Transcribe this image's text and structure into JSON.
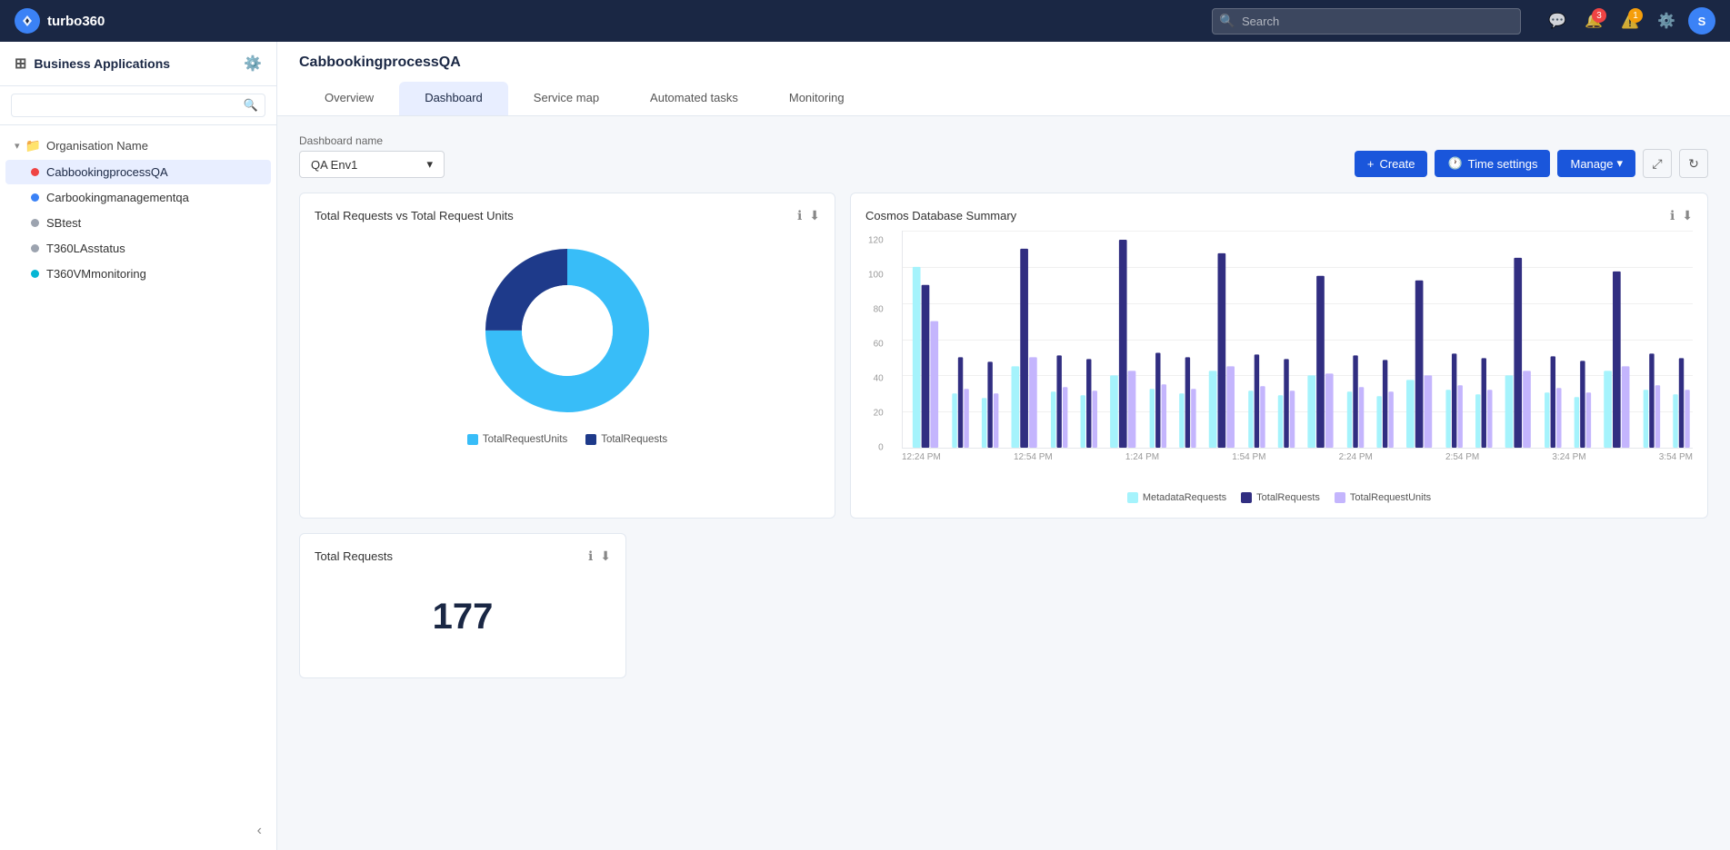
{
  "app": {
    "name": "turbo360",
    "logo_char": "T"
  },
  "topnav": {
    "search_placeholder": "Search",
    "notification_badge": "3",
    "alert_badge": "1",
    "avatar_char": "S"
  },
  "sidebar": {
    "title": "Business Applications",
    "search_placeholder": "",
    "org_name": "Organisation Name",
    "items": [
      {
        "id": "cabbookingprocessqa",
        "label": "CabbookingprocessQA",
        "dot": "red",
        "active": true
      },
      {
        "id": "carbookingmanagementqa",
        "label": "Carbookingmanagementqa",
        "dot": "blue",
        "active": false
      },
      {
        "id": "sbtest",
        "label": "SBtest",
        "dot": "gray",
        "active": false
      },
      {
        "id": "t360lastatus",
        "label": "T360LAsstatus",
        "dot": "gray",
        "active": false
      },
      {
        "id": "t360vmmonitoring",
        "label": "T360VMmonitoring",
        "dot": "teal",
        "active": false
      }
    ]
  },
  "main": {
    "title": "CabbookingprocessQA",
    "tabs": [
      {
        "id": "overview",
        "label": "Overview",
        "active": false
      },
      {
        "id": "dashboard",
        "label": "Dashboard",
        "active": true
      },
      {
        "id": "service-map",
        "label": "Service map",
        "active": false
      },
      {
        "id": "automated-tasks",
        "label": "Automated tasks",
        "active": false
      },
      {
        "id": "monitoring",
        "label": "Monitoring",
        "active": false
      }
    ],
    "dashboard": {
      "name_label": "Dashboard name",
      "dropdown_value": "QA Env1",
      "buttons": {
        "create": "+ Create",
        "time_settings": "Time settings",
        "manage": "Manage"
      }
    },
    "charts": {
      "donut": {
        "title": "Total Requests vs Total Request Units",
        "legend": [
          {
            "label": "TotalRequestUnits",
            "color": "#38bdf8"
          },
          {
            "label": "TotalRequests",
            "color": "#1e3a8a"
          }
        ],
        "values": [
          75,
          25
        ]
      },
      "bar": {
        "title": "Cosmos Database Summary",
        "y_labels": [
          "120",
          "100",
          "80",
          "60",
          "40",
          "20",
          "0"
        ],
        "x_labels": [
          "12:24 PM",
          "12:54 PM",
          "1:24 PM",
          "1:54 PM",
          "2:24 PM",
          "2:54 PM",
          "3:24 PM",
          "3:54 PM"
        ],
        "legend": [
          {
            "label": "MetadataRequests",
            "color": "#a5f3fc"
          },
          {
            "label": "TotalRequests",
            "color": "#312e81"
          },
          {
            "label": "TotalRequestUnits",
            "color": "#c4b5fd"
          }
        ]
      },
      "stat": {
        "title": "Total Requests",
        "value": "177"
      }
    }
  }
}
